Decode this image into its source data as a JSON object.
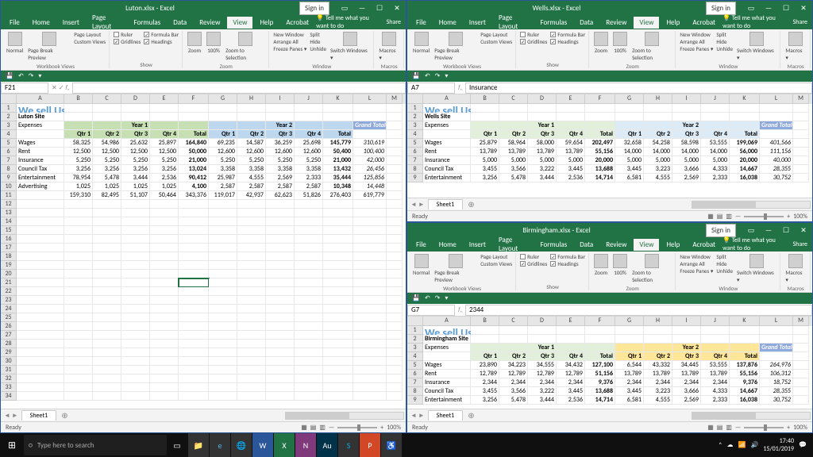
{
  "windows": {
    "luton": {
      "title": "Luton.xlsx - Excel",
      "signin": "Sign in",
      "namebox": "F21",
      "fxvalue": "",
      "site": "Luton Site",
      "selected_cell": "F21"
    },
    "wells": {
      "title": "Wells.xlsx - Excel",
      "signin": "Sign in",
      "namebox": "A7",
      "fxvalue": "Insurance",
      "site": "Wells Site"
    },
    "birmingham": {
      "title": "Birmingham.xlsx - Excel",
      "signin": "Sign in",
      "namebox": "G7",
      "fxvalue": "2344",
      "site": "Birmingham Site"
    }
  },
  "common": {
    "brand": "We sell Used Cars",
    "expenses": "Expenses",
    "year1": "Year 1",
    "year2": "Year 2",
    "grand_total": "Grand Total",
    "qtrs": [
      "Qtr 1",
      "Qtr 2",
      "Qtr 3",
      "Qtr 4",
      "Total",
      "Qtr 1",
      "Qtr 2",
      "Qtr 3",
      "Qtr 4",
      "Total"
    ],
    "menu": [
      "File",
      "Home",
      "Insert",
      "Page Layout",
      "Formulas",
      "Data",
      "Review",
      "View",
      "Help",
      "Acrobat"
    ],
    "tellme": "Tell me what you want to do",
    "share": "Share",
    "sheet": "Sheet1",
    "ready": "Ready",
    "zoom": "100%"
  },
  "ribbon": {
    "groups": {
      "workbook_views": "Workbook Views",
      "show": "Show",
      "zoom": "Zoom",
      "window": "Window",
      "macros": "Macros"
    },
    "btns": {
      "normal": "Normal",
      "page_break": "Page Break\nPreview",
      "page_layout": "Page Layout",
      "custom_views": "Custom Views",
      "ruler": "Ruler",
      "formula_bar": "Formula Bar",
      "gridlines": "Gridlines",
      "headings": "Headings",
      "zoom": "Zoom",
      "hundred": "100%",
      "zoom_sel": "Zoom to\nSelection",
      "new_window": "New Window",
      "arrange_all": "Arrange All",
      "freeze_panes": "Freeze Panes ▾",
      "split": "Split",
      "hide": "Hide",
      "unhide": "Unhide",
      "switch_windows": "Switch\nWindows ▾",
      "macros": "Macros\n▾"
    }
  },
  "columns": [
    "A",
    "B",
    "C",
    "D",
    "E",
    "F",
    "G",
    "H",
    "I",
    "J",
    "K",
    "L",
    "M"
  ],
  "row_labels": [
    "Wages",
    "Rent",
    "Insurance",
    "Council Tax",
    "Entertainment",
    "Advertising"
  ],
  "data": {
    "luton": [
      [
        "58,325",
        "54,986",
        "25,632",
        "25,897",
        "164,840",
        "69,235",
        "14,587",
        "36,259",
        "25,698",
        "145,779",
        "310,619"
      ],
      [
        "12,500",
        "12,500",
        "12,500",
        "12,500",
        "50,000",
        "12,600",
        "12,600",
        "12,600",
        "12,600",
        "50,400",
        "100,400"
      ],
      [
        "5,250",
        "5,250",
        "5,250",
        "5,250",
        "21,000",
        "5,250",
        "5,250",
        "5,250",
        "5,250",
        "21,000",
        "42,000"
      ],
      [
        "3,256",
        "3,256",
        "3,256",
        "3,256",
        "13,024",
        "3,358",
        "3,358",
        "3,358",
        "3,358",
        "13,432",
        "26,456"
      ],
      [
        "78,954",
        "5,478",
        "3,444",
        "2,536",
        "90,412",
        "25,987",
        "4,555",
        "2,569",
        "2,333",
        "35,444",
        "125,856"
      ],
      [
        "1,025",
        "1,025",
        "1,025",
        "1,025",
        "4,100",
        "2,587",
        "2,587",
        "2,587",
        "2,587",
        "10,348",
        "14,448"
      ]
    ],
    "luton_totals": [
      "159,310",
      "82,495",
      "51,107",
      "50,464",
      "343,376",
      "119,017",
      "42,937",
      "62,623",
      "51,826",
      "276,403",
      "619,779"
    ],
    "wells": [
      [
        "25,879",
        "58,964",
        "58,000",
        "59,654",
        "202,497",
        "32,658",
        "54,258",
        "58,598",
        "53,555",
        "199,069",
        "401,566"
      ],
      [
        "13,789",
        "13,789",
        "13,789",
        "13,789",
        "55,156",
        "14,000",
        "14,000",
        "14,000",
        "14,000",
        "56,000",
        "111,156"
      ],
      [
        "5,000",
        "5,000",
        "5,000",
        "5,000",
        "20,000",
        "5,000",
        "5,000",
        "5,000",
        "5,000",
        "20,000",
        "40,000"
      ],
      [
        "3,455",
        "3,566",
        "3,222",
        "3,445",
        "13,688",
        "3,445",
        "3,223",
        "3,666",
        "4,333",
        "14,667",
        "28,355"
      ],
      [
        "3,256",
        "5,478",
        "3,444",
        "2,536",
        "14,714",
        "6,581",
        "4,555",
        "2,569",
        "2,333",
        "16,038",
        "30,752"
      ]
    ],
    "birmingham": [
      [
        "23,890",
        "34,223",
        "34,555",
        "34,432",
        "127,100",
        "6,544",
        "43,332",
        "34,445",
        "53,555",
        "137,876",
        "264,976"
      ],
      [
        "12,789",
        "12,789",
        "12,789",
        "12,789",
        "51,156",
        "13,789",
        "13,789",
        "13,789",
        "13,789",
        "55,156",
        "106,312"
      ],
      [
        "2,344",
        "2,344",
        "2,344",
        "2,344",
        "9,376",
        "2,344",
        "2,344",
        "2,344",
        "2,344",
        "9,376",
        "18,752"
      ],
      [
        "3,455",
        "3,566",
        "3,222",
        "3,445",
        "13,688",
        "3,445",
        "3,223",
        "3,666",
        "4,333",
        "14,667",
        "28,355"
      ],
      [
        "3,256",
        "5,478",
        "3,444",
        "2,536",
        "14,714",
        "6,581",
        "4,555",
        "2,569",
        "2,333",
        "16,038",
        "30,752"
      ]
    ]
  },
  "taskbar": {
    "search": "Type here to search",
    "time": "17:40",
    "date": "15/01/2019"
  }
}
